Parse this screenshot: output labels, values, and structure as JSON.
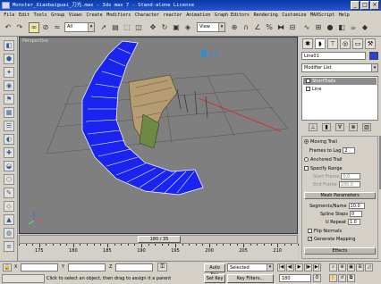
{
  "title": "Monster_Xiaobaiguai_刀光.max - 3ds max 7 - Stand-alone License",
  "window_buttons": [
    "_",
    "□",
    "×"
  ],
  "menu": [
    "File",
    "Edit",
    "Tools",
    "Group",
    "Views",
    "Create",
    "Modifiers",
    "Character",
    "reactor",
    "Animation",
    "Graph Editors",
    "Rendering",
    "Customize",
    "MAXScript",
    "Help"
  ],
  "toolbar": {
    "selection_filter": "All",
    "ref_coord": "View"
  },
  "viewport": {
    "label": "Perspective",
    "watermark": "CG"
  },
  "panel": {
    "object_name": "Line01",
    "object_color": "#2d3fe0",
    "modifier_list": "Modifier List",
    "stack": [
      "ShortTrails",
      "Line"
    ],
    "rollout": {
      "moving_trail": "Moving Trail",
      "frames_to_lag_label": "Frames to Lag",
      "frames_to_lag": "2",
      "anchored_trail": "Anchored Trail",
      "specify_range": "Specify Range",
      "start_frame_label": "Start Frame",
      "start_frame": "0.0",
      "end_frame_label": "End Frame",
      "end_frame": "100.0",
      "mesh_header": "Mesh Parameters",
      "segments_label": "Segments/Name",
      "segments": "10.0",
      "spline_steps_label": "Spline Steps",
      "spline_steps": "0",
      "u_repeat_label": "U Repeat",
      "u_repeat": "1.0",
      "flip_normals": "Flip Normals",
      "generate_mapping": "Generate Mapping",
      "effects_header": "Effects"
    }
  },
  "timeline": {
    "slider": "180 / 35",
    "current": 180,
    "ticks": [
      175,
      180,
      185,
      190,
      195,
      200,
      205,
      210
    ]
  },
  "status": {
    "x_label": "X",
    "y_label": "Y",
    "z_label": "Z",
    "prompt": "Click to select an object, then drag to assign it a parent",
    "auto_key": "Auto Key",
    "set_key": "Set Key",
    "selected": "Selected",
    "key_filters": "Key Filters...",
    "frame": "180"
  }
}
